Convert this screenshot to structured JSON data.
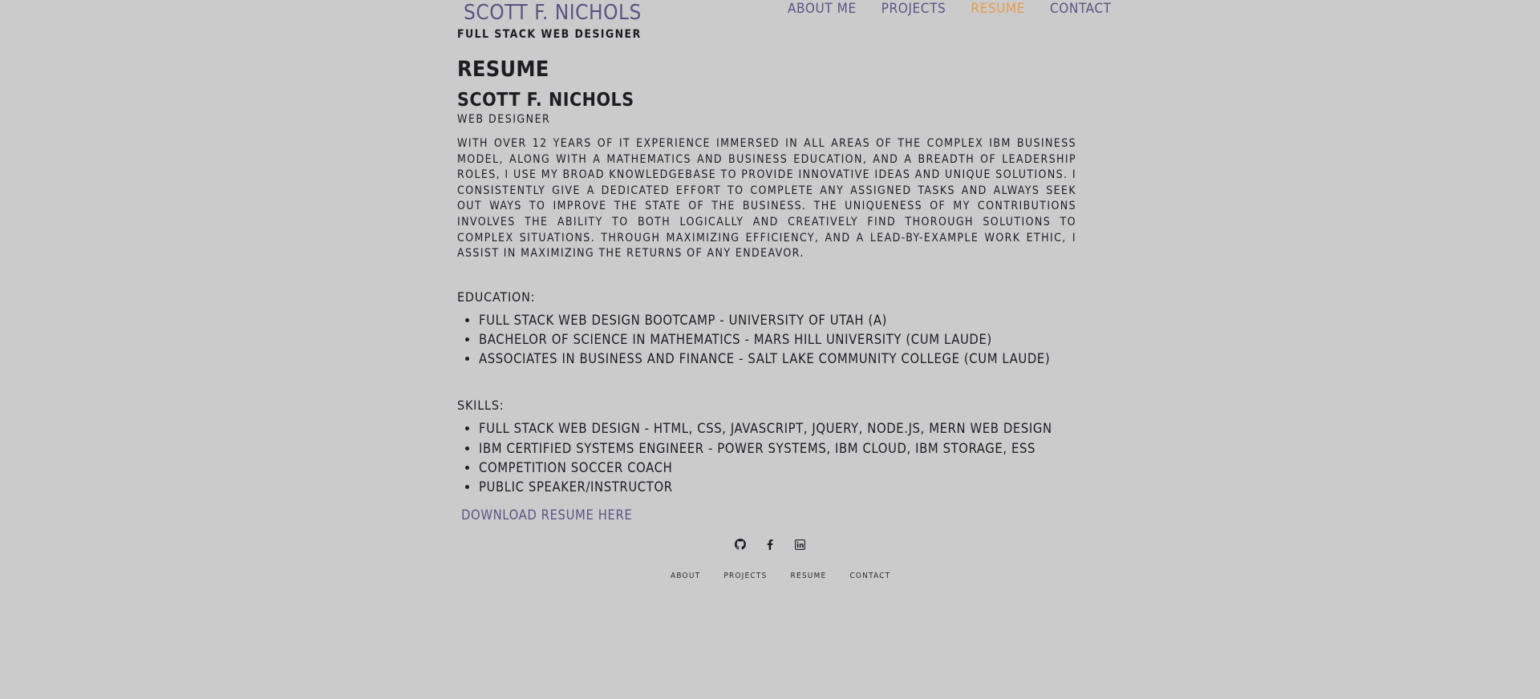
{
  "header": {
    "brand_name": "Scott F. Nichols",
    "brand_subtitle": "Full Stack Web Designer",
    "nav": [
      {
        "label": "About Me",
        "active": false
      },
      {
        "label": "Projects",
        "active": false
      },
      {
        "label": "Resume",
        "active": true
      },
      {
        "label": "Contact",
        "active": false
      }
    ]
  },
  "main": {
    "page_title": "Resume",
    "name": "Scott F. Nichols",
    "role": "Web Designer",
    "summary": "With over 12 years of IT experience immersed in all areas of the complex IBM business model, along with a mathematics and business education, and a breadth of leadership roles, I use my broad knowledgebase to provide innovative ideas and unique solutions. I consistently give a dedicated effort to complete any assigned tasks and always seek out ways to improve the state of the business. The uniqueness of my contributions involves the ability to both logically and creatively find thorough solutions to complex situations. Through maximizing efficiency, and a lead-by-example work ethic, I assist in maximizing the returns of any endeavor.",
    "education": {
      "heading": "Education:",
      "items": [
        "Full Stack Web Design Bootcamp - University of Utah (A)",
        "Bachelor of Science in Mathematics - Mars Hill University (Cum Laude)",
        "Associates in Business and Finance - Salt Lake Community College (Cum Laude)"
      ]
    },
    "skills": {
      "heading": "Skills:",
      "items": [
        "Full Stack Web Design - HTML, CSS, JavaScript, jQuery, Node.js, MERN Web Design",
        "IBM Certified Systems Engineer - Power Systems, IBM Cloud, IBM Storage, ESS",
        "Competition Soccer Coach",
        "Public Speaker/Instructor"
      ]
    },
    "download_label": "Download Resume Here"
  },
  "footer": {
    "social_icons": [
      "github-icon",
      "facebook-icon",
      "linkedin-icon"
    ],
    "nav": [
      "About",
      "Projects",
      "Resume",
      "Contact"
    ]
  },
  "colors": {
    "background": "#cccbcc",
    "accent": "#5a5484",
    "active": "#e79a4c",
    "text": "#1d1d22"
  }
}
